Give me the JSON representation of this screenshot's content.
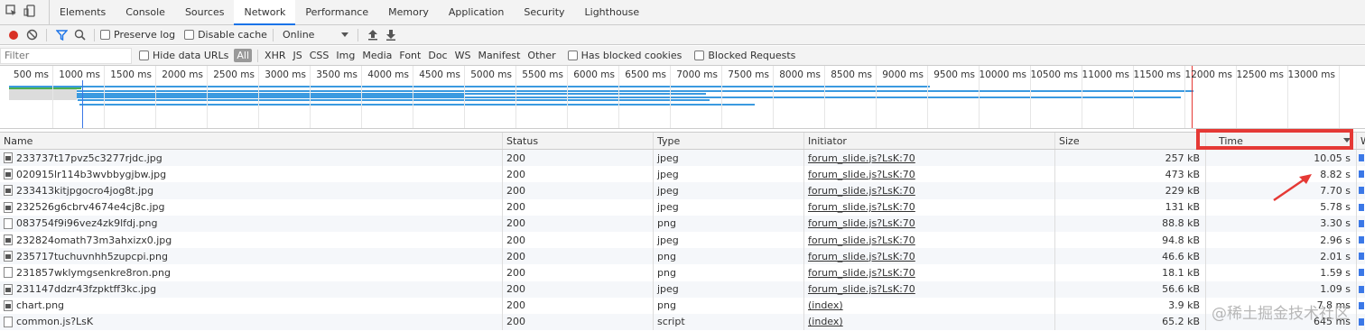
{
  "tabs": [
    {
      "label": "Elements",
      "active": false
    },
    {
      "label": "Console",
      "active": false
    },
    {
      "label": "Sources",
      "active": false
    },
    {
      "label": "Network",
      "active": true
    },
    {
      "label": "Performance",
      "active": false
    },
    {
      "label": "Memory",
      "active": false
    },
    {
      "label": "Application",
      "active": false
    },
    {
      "label": "Security",
      "active": false
    },
    {
      "label": "Lighthouse",
      "active": false
    }
  ],
  "toolbar": {
    "preserve_log": "Preserve log",
    "disable_cache": "Disable cache",
    "throttle": "Online"
  },
  "filter": {
    "placeholder": "Filter",
    "hide_data_urls": "Hide data URLs",
    "types": [
      "All",
      "XHR",
      "JS",
      "CSS",
      "Img",
      "Media",
      "Font",
      "Doc",
      "WS",
      "Manifest",
      "Other"
    ],
    "active_type": "All",
    "has_blocked_cookies": "Has blocked cookies",
    "blocked_requests": "Blocked Requests"
  },
  "overview": {
    "tick_labels": [
      "500 ms",
      "1000 ms",
      "1500 ms",
      "2000 ms",
      "2500 ms",
      "3000 ms",
      "3500 ms",
      "4000 ms",
      "4500 ms",
      "5000 ms",
      "5500 ms",
      "6000 ms",
      "6500 ms",
      "7000 ms",
      "7500 ms",
      "8000 ms",
      "8500 ms",
      "9000 ms",
      "9500 ms",
      "10000 ms",
      "10500 ms",
      "11000 ms",
      "11500 ms",
      "12000 ms",
      "12500 ms",
      "13000 ms",
      "135"
    ]
  },
  "columns": {
    "name": "Name",
    "status": "Status",
    "type": "Type",
    "initiator": "Initiator",
    "size": "Size",
    "time": "Time",
    "waterfall": "W"
  },
  "rows": [
    {
      "name": "233737t17pvz5c3277rjdc.jpg",
      "status": "200",
      "type": "jpeg",
      "initiator": "forum_slide.js?LsK:70",
      "size": "257 kB",
      "time": "10.05 s"
    },
    {
      "name": "020915lr114b3wvbbygjbw.jpg",
      "status": "200",
      "type": "jpeg",
      "initiator": "forum_slide.js?LsK:70",
      "size": "473 kB",
      "time": "8.82 s"
    },
    {
      "name": "233413kitjpgocro4jog8t.jpg",
      "status": "200",
      "type": "jpeg",
      "initiator": "forum_slide.js?LsK:70",
      "size": "229 kB",
      "time": "7.70 s"
    },
    {
      "name": "232526g6cbrv4674e4cj8c.jpg",
      "status": "200",
      "type": "jpeg",
      "initiator": "forum_slide.js?LsK:70",
      "size": "131 kB",
      "time": "5.78 s"
    },
    {
      "name": "083754f9i96vez4zk9lfdj.png",
      "status": "200",
      "type": "png",
      "initiator": "forum_slide.js?LsK:70",
      "size": "88.8 kB",
      "time": "3.30 s"
    },
    {
      "name": "232824omath73m3ahxizx0.jpg",
      "status": "200",
      "type": "jpeg",
      "initiator": "forum_slide.js?LsK:70",
      "size": "94.8 kB",
      "time": "2.96 s"
    },
    {
      "name": "235717tuchuvnhh5zupcpi.png",
      "status": "200",
      "type": "png",
      "initiator": "forum_slide.js?LsK:70",
      "size": "46.6 kB",
      "time": "2.01 s"
    },
    {
      "name": "231857wklymgsenkre8ron.png",
      "status": "200",
      "type": "png",
      "initiator": "forum_slide.js?LsK:70",
      "size": "18.1 kB",
      "time": "1.59 s"
    },
    {
      "name": "231147ddzr43fzpktff3kc.jpg",
      "status": "200",
      "type": "jpeg",
      "initiator": "forum_slide.js?LsK:70",
      "size": "56.6 kB",
      "time": "1.09 s"
    },
    {
      "name": "chart.png",
      "status": "200",
      "type": "png",
      "initiator": "(index)",
      "size": "3.9 kB",
      "time": "7.8 ms"
    },
    {
      "name": "common.js?LsK",
      "status": "200",
      "type": "script",
      "initiator": "(index)",
      "size": "65.2 kB",
      "time": "645 ms"
    }
  ],
  "watermark": "@稀土掘金技术社区",
  "colors": {
    "accent": "#1a73e8",
    "highlight": "#e53935",
    "record": "#d93025"
  }
}
